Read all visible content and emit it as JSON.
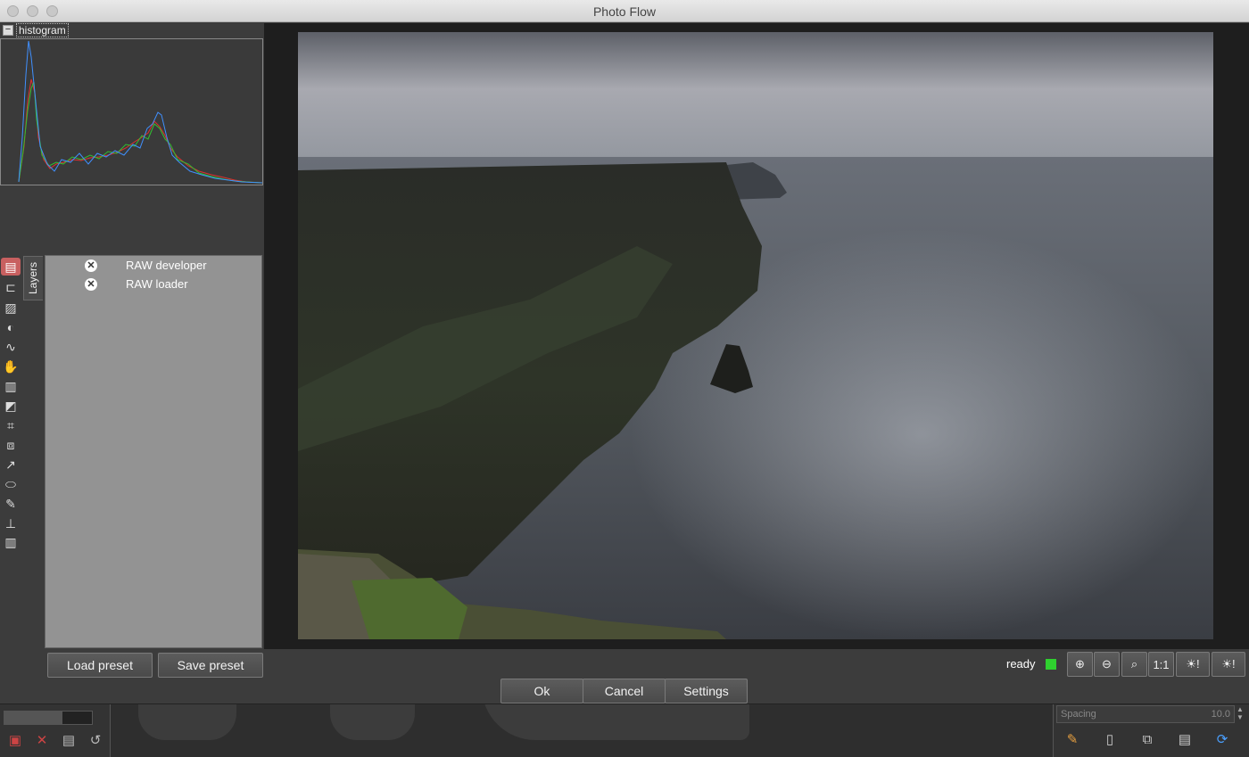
{
  "window": {
    "title": "Photo Flow"
  },
  "histogram": {
    "label": "histogram",
    "toggle": "−"
  },
  "layers": {
    "tab_label": "Layers",
    "items": [
      {
        "label": "RAW developer",
        "remove_icon": "close-icon"
      },
      {
        "label": "RAW loader",
        "remove_icon": "close-icon"
      }
    ]
  },
  "tools": [
    "layers-icon",
    "group-icon",
    "image-icon",
    "contrast-icon",
    "curves-icon",
    "fill-icon",
    "gradient-icon",
    "levels-icon",
    "crop-icon",
    "transform-icon",
    "clone-icon",
    "ellipse-icon",
    "brush-icon",
    "stamp-icon",
    "trash-icon"
  ],
  "buttons": {
    "load_preset": "Load preset",
    "save_preset": "Save preset",
    "ok": "Ok",
    "cancel": "Cancel",
    "settings": "Settings"
  },
  "status": {
    "text": "ready",
    "color": "#2fd12f"
  },
  "zoom": {
    "one_to_one": "1:1"
  },
  "background": {
    "spacing_label": "Spacing",
    "spacing_value": "10.0"
  }
}
